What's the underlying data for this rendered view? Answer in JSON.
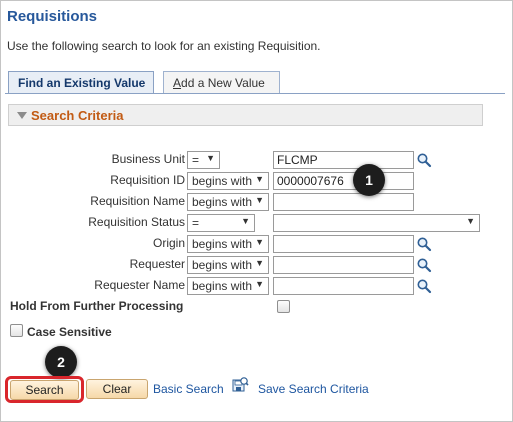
{
  "page": {
    "title": "Requisitions",
    "instructions": "Use the following search to look for an existing Requisition."
  },
  "tabs": [
    {
      "label": "Find an Existing Value",
      "active": true
    },
    {
      "label_underlined": "A",
      "label_rest": "dd a New Value",
      "active": false
    }
  ],
  "section": {
    "title": "Search Criteria"
  },
  "fields": {
    "business_unit": {
      "label": "Business Unit",
      "operator": "=",
      "value": "FLCMP"
    },
    "requisition_id": {
      "label": "Requisition ID",
      "operator": "begins with",
      "value": "0000007676"
    },
    "requisition_name": {
      "label": "Requisition Name",
      "operator": "begins with",
      "value": ""
    },
    "requisition_status": {
      "label": "Requisition Status",
      "operator": "=",
      "value": ""
    },
    "origin": {
      "label": "Origin",
      "operator": "begins with",
      "value": ""
    },
    "requester": {
      "label": "Requester",
      "operator": "begins with",
      "value": ""
    },
    "requester_name": {
      "label": "Requester Name",
      "operator": "begins with",
      "value": ""
    }
  },
  "checkboxes": {
    "hold": {
      "label": "Hold From Further Processing",
      "checked": false
    },
    "case_sensitive": {
      "label": "Case Sensitive",
      "checked": false
    }
  },
  "callouts": {
    "one": "1",
    "two": "2"
  },
  "buttons": {
    "search": "Search",
    "clear": "Clear",
    "basic_search": "Basic Search",
    "save_search": "Save Search Criteria"
  },
  "icons": {
    "lookup": "magnifier-icon",
    "save": "save-search-icon"
  },
  "colors": {
    "title": "#27589b",
    "section_title": "#c25b14",
    "link": "#1e56a0",
    "highlight": "#d9262c"
  }
}
